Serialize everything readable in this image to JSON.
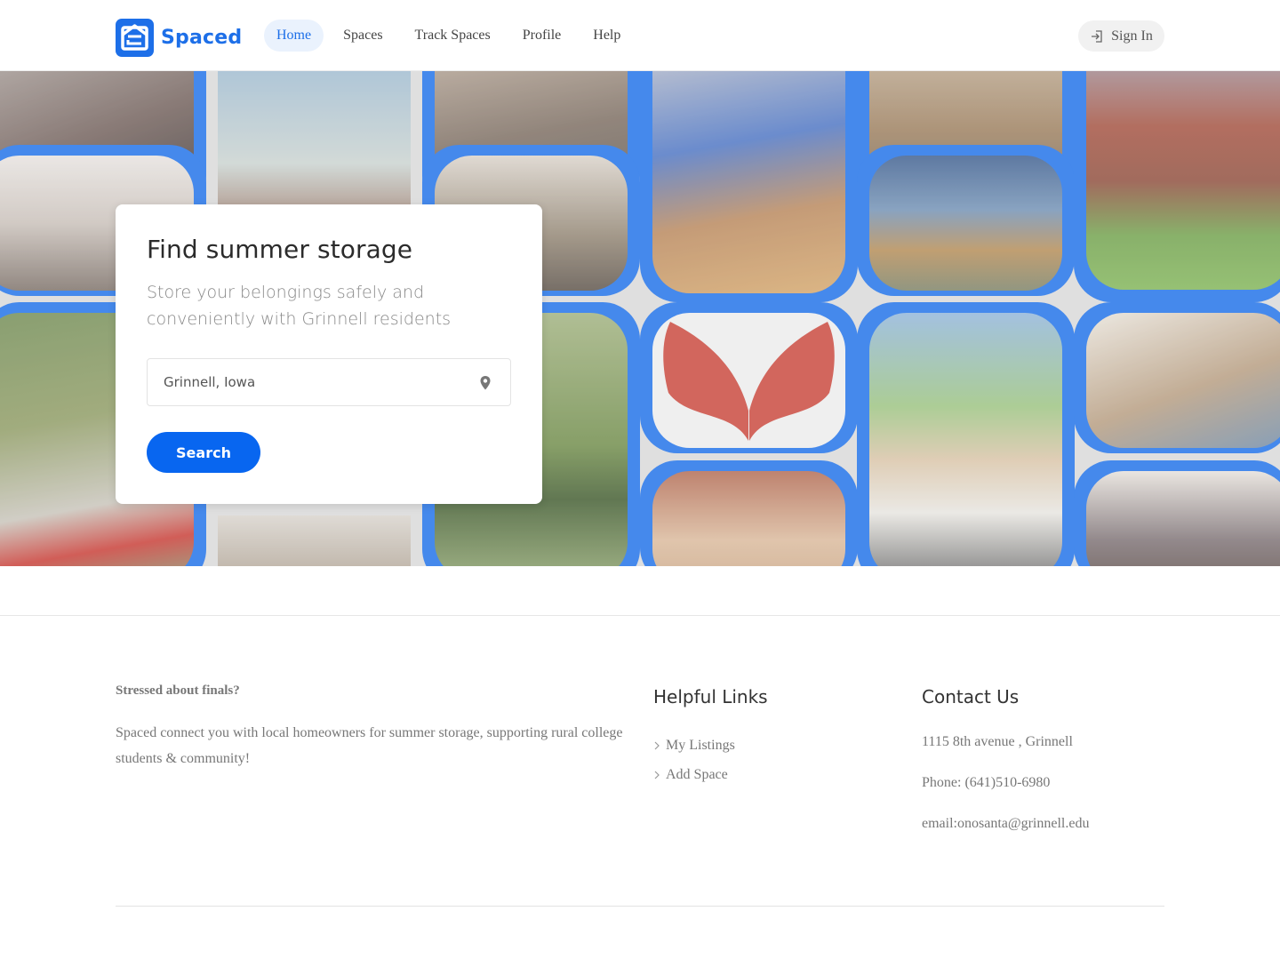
{
  "header": {
    "logo_text": "Spaced",
    "nav": [
      {
        "label": "Home",
        "active": true
      },
      {
        "label": "Spaces",
        "active": false
      },
      {
        "label": "Track Spaces",
        "active": false
      },
      {
        "label": "Profile",
        "active": false
      },
      {
        "label": "Help",
        "active": false
      }
    ],
    "signin_label": "Sign In",
    "signin_icon": "sign-in-icon"
  },
  "hero": {
    "title": "Find summer storage",
    "subtitle": "Store your belongings safely and conveniently with Grinnell residents",
    "location_value": "Grinnell, Iowa",
    "location_icon": "map-pin-icon",
    "search_label": "Search"
  },
  "footer": {
    "about_title": "Stressed about finals?",
    "about_text": "Spaced connect you with local homeowners for summer storage, supporting rural college students & community!",
    "links_title": "Helpful Links",
    "links": [
      "My Listings",
      "Add Space"
    ],
    "contact_title": "Contact Us",
    "address": "1115 8th avenue , Grinnell",
    "phone": "Phone: (641)510-6980",
    "email": "email:onosanta@grinnell.edu"
  },
  "colors": {
    "brand": "#1d6fe8",
    "button": "#0866f0",
    "nav_active_bg": "#eaf2fd"
  }
}
